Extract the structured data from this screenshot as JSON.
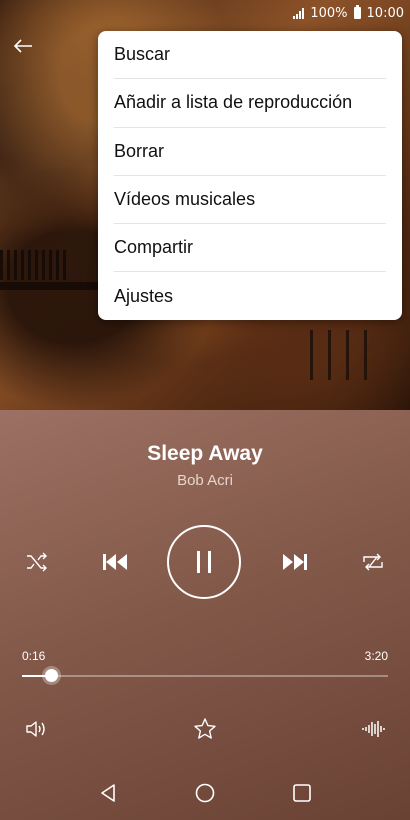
{
  "status": {
    "signal_icon": "signal-icon",
    "battery_percent": "100%",
    "battery_icon": "battery-icon",
    "time": "10:00"
  },
  "menu": {
    "items": [
      {
        "label": "Buscar"
      },
      {
        "label": "Añadir a lista de reproducción"
      },
      {
        "label": "Borrar"
      },
      {
        "label": "Vídeos musicales"
      },
      {
        "label": "Compartir"
      },
      {
        "label": "Ajustes"
      }
    ]
  },
  "track": {
    "title": "Sleep Away",
    "artist": "Bob Acri"
  },
  "progress": {
    "elapsed": "0:16",
    "duration": "3:20",
    "fraction": 0.08
  },
  "icons": {
    "back": "back-arrow-icon",
    "shuffle": "shuffle-icon",
    "previous": "previous-track-icon",
    "pause": "pause-icon",
    "next": "next-track-icon",
    "repeat": "repeat-icon",
    "volume": "volume-icon",
    "favorite": "star-icon",
    "equalizer": "equalizer-icon",
    "nav_back": "nav-back-icon",
    "nav_home": "nav-home-icon",
    "nav_recents": "nav-recents-icon"
  },
  "colors": {
    "panel": "#83594a",
    "menu_bg": "#ffffff",
    "text": "#ffffff"
  }
}
